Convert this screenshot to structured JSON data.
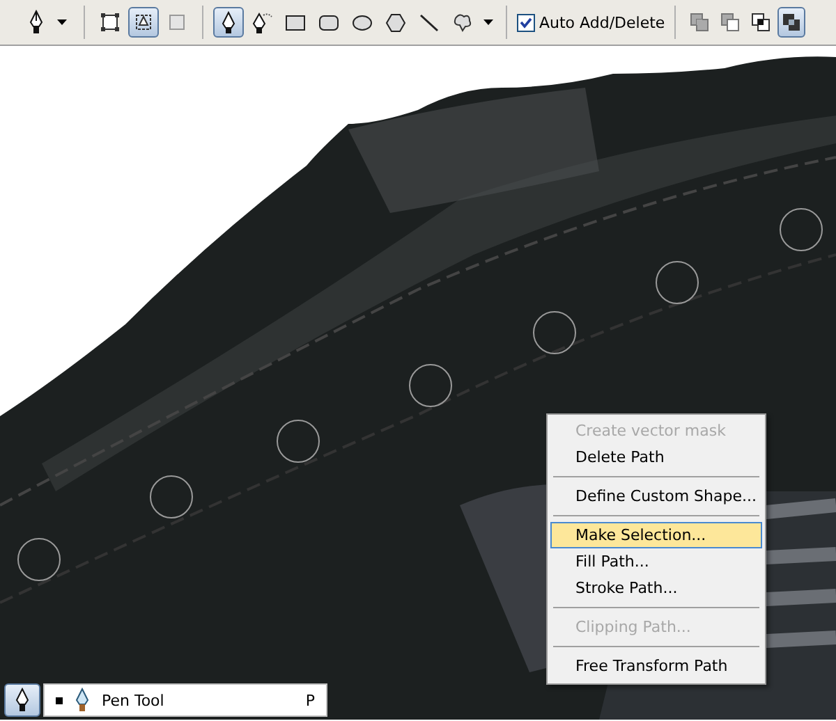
{
  "toolbar": {
    "preset_tool": {
      "kind": "pen",
      "selected": false
    },
    "modes": [
      {
        "kind": "shape-layers",
        "selected": false
      },
      {
        "kind": "paths",
        "selected": true
      },
      {
        "kind": "fill-pixels",
        "selected": false
      }
    ],
    "tools": [
      {
        "kind": "pen",
        "selected": true
      },
      {
        "kind": "freeform-pen",
        "selected": false
      },
      {
        "kind": "rectangle",
        "selected": false
      },
      {
        "kind": "rounded-rectangle",
        "selected": false
      },
      {
        "kind": "ellipse",
        "selected": false
      },
      {
        "kind": "polygon",
        "selected": false
      },
      {
        "kind": "line",
        "selected": false
      },
      {
        "kind": "custom-shape",
        "selected": false
      }
    ],
    "auto_add_delete": {
      "label": "Auto Add/Delete",
      "checked": true
    },
    "path_operations": [
      {
        "kind": "add",
        "selected": false
      },
      {
        "kind": "subtract",
        "selected": false
      },
      {
        "kind": "intersect",
        "selected": false
      },
      {
        "kind": "exclude",
        "selected": true
      }
    ]
  },
  "context_menu": {
    "items": [
      {
        "label": "Create vector mask",
        "disabled": true,
        "selected": false,
        "separator_after": false
      },
      {
        "label": "Delete Path",
        "disabled": false,
        "selected": false,
        "separator_after": true
      },
      {
        "label": "Define Custom Shape...",
        "disabled": false,
        "selected": false,
        "separator_after": true
      },
      {
        "label": "Make Selection...",
        "disabled": false,
        "selected": true,
        "separator_after": false
      },
      {
        "label": "Fill Path...",
        "disabled": false,
        "selected": false,
        "separator_after": false
      },
      {
        "label": "Stroke Path...",
        "disabled": false,
        "selected": false,
        "separator_after": true
      },
      {
        "label": "Clipping Path...",
        "disabled": true,
        "selected": false,
        "separator_after": true
      },
      {
        "label": "Free Transform Path",
        "disabled": false,
        "selected": false,
        "separator_after": false
      }
    ]
  },
  "tool_flyout": {
    "items": [
      {
        "label": "Pen Tool",
        "shortcut": "P",
        "selected": true
      }
    ]
  }
}
